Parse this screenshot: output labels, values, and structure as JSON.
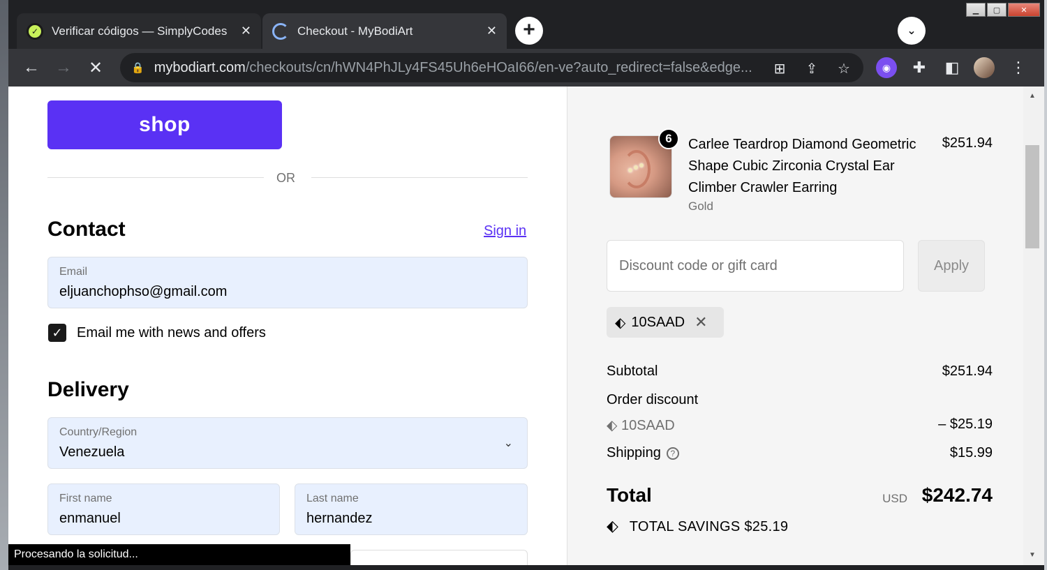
{
  "browser": {
    "tabs": [
      {
        "label": "Verificar códigos — SimplyCodes",
        "icon": "simplycodes-icon",
        "active": false
      },
      {
        "label": "Checkout - MyBodiArt",
        "icon": "loading-spinner-icon",
        "active": true
      }
    ],
    "url_host": "mybodiart.com",
    "url_path": "/checkouts/cn/hWN4PhJLy4FS45Uh6eHOaI66/en-ve?auto_redirect=false&edge...",
    "status_text": "Procesando la solicitud..."
  },
  "checkout": {
    "shop_button": "shop",
    "or_text": "OR",
    "contact": {
      "heading": "Contact",
      "sign_in": "Sign in",
      "email_label": "Email",
      "email_value": "eljuanchophso@gmail.com",
      "newsletter_label": "Email me with news and offers",
      "newsletter_checked": true
    },
    "delivery": {
      "heading": "Delivery",
      "country_label": "Country/Region",
      "country_value": "Venezuela",
      "first_name_label": "First name",
      "first_name_value": "enmanuel",
      "last_name_label": "Last name",
      "last_name_value": "hernandez"
    }
  },
  "summary": {
    "product": {
      "name": "Carlee Teardrop Diamond Geometric Shape Cubic Zirconia Crystal Ear Climber Crawler Earring",
      "variant": "Gold",
      "price": "$251.94",
      "quantity": "6"
    },
    "discount_placeholder": "Discount code or gift card",
    "apply_label": "Apply",
    "applied_code": "10SAAD",
    "subtotal_label": "Subtotal",
    "subtotal_value": "$251.94",
    "order_discount_label": "Order discount",
    "discount_code": "10SAAD",
    "discount_value": "– $25.19",
    "shipping_label": "Shipping",
    "shipping_value": "$15.99",
    "total_label": "Total",
    "total_currency": "USD",
    "total_value": "$242.74",
    "savings_label": "TOTAL SAVINGS",
    "savings_value": "$25.19"
  },
  "colors": {
    "shop_purple": "#5a31f4",
    "autofill_blue": "#e8f0fe",
    "browser_dark": "#202124"
  }
}
